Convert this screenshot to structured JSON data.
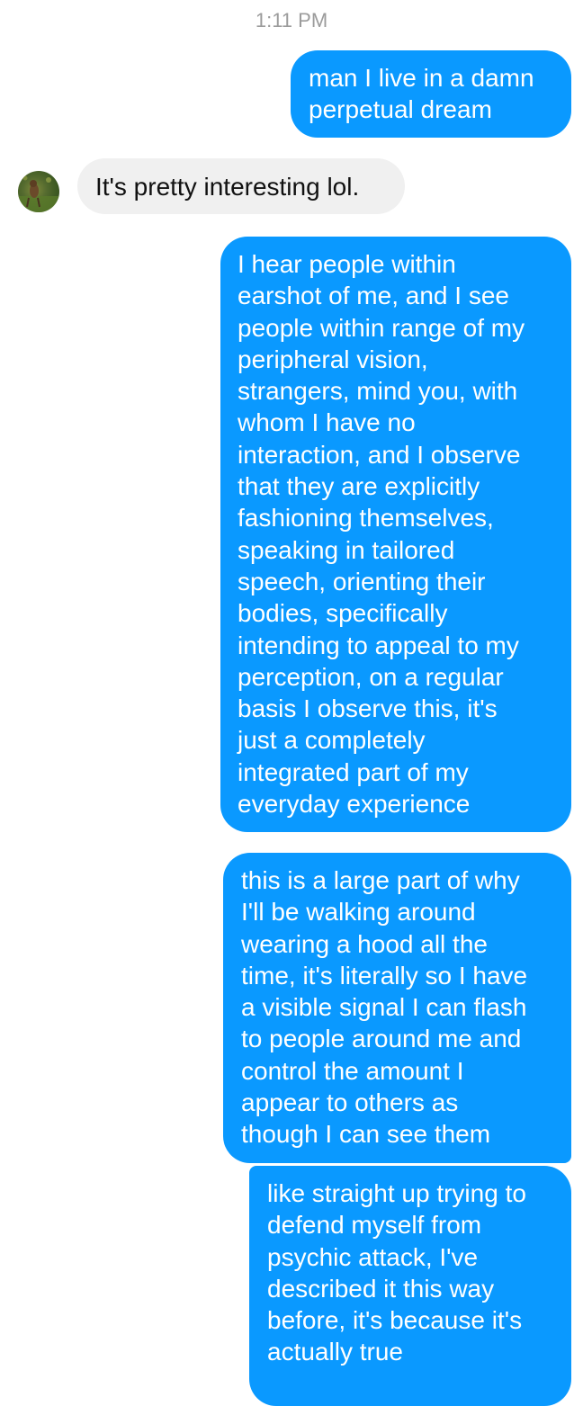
{
  "conversation": {
    "timestamp": "1:11 PM",
    "messages": [
      {
        "sender": "me",
        "lines": [
          "man I live in a damn",
          "perpetual dream"
        ]
      },
      {
        "sender": "contact",
        "lines": [
          "It's pretty interesting lol."
        ]
      },
      {
        "sender": "me",
        "lines": [
          "I hear people within",
          "earshot of me, and I see",
          "people within range of my",
          "peripheral vision,",
          "strangers, mind you, with",
          "whom I have no",
          "interaction, and I observe",
          "that they are explicitly",
          "fashioning themselves,",
          "speaking in tailored",
          "speech, orienting their",
          "bodies, specifically",
          "intending to appeal to my",
          "perception, on a regular",
          "basis I observe this, it's",
          "just a completely",
          "integrated part of my",
          "everyday experience"
        ]
      },
      {
        "sender": "me",
        "lines": [
          "this is a large part of why",
          "I'll be walking around",
          "wearing a hood all the",
          "time, it's literally so I have",
          "a visible signal I can flash",
          "to people around me and",
          "control the amount I",
          "appear to others as",
          "though I can see them"
        ]
      },
      {
        "sender": "me",
        "lines": [
          "like straight up trying to",
          "defend myself from",
          "psychic attack, I've",
          "described it this way",
          "before, it's because it's",
          "actually true"
        ]
      }
    ]
  },
  "colors": {
    "outgoing_bubble": "#0a99ff",
    "incoming_bubble": "#f0f0f0",
    "timestamp_text": "#9b9b9b"
  },
  "contact": {
    "avatar_icon": "profile-photo-avatar"
  }
}
